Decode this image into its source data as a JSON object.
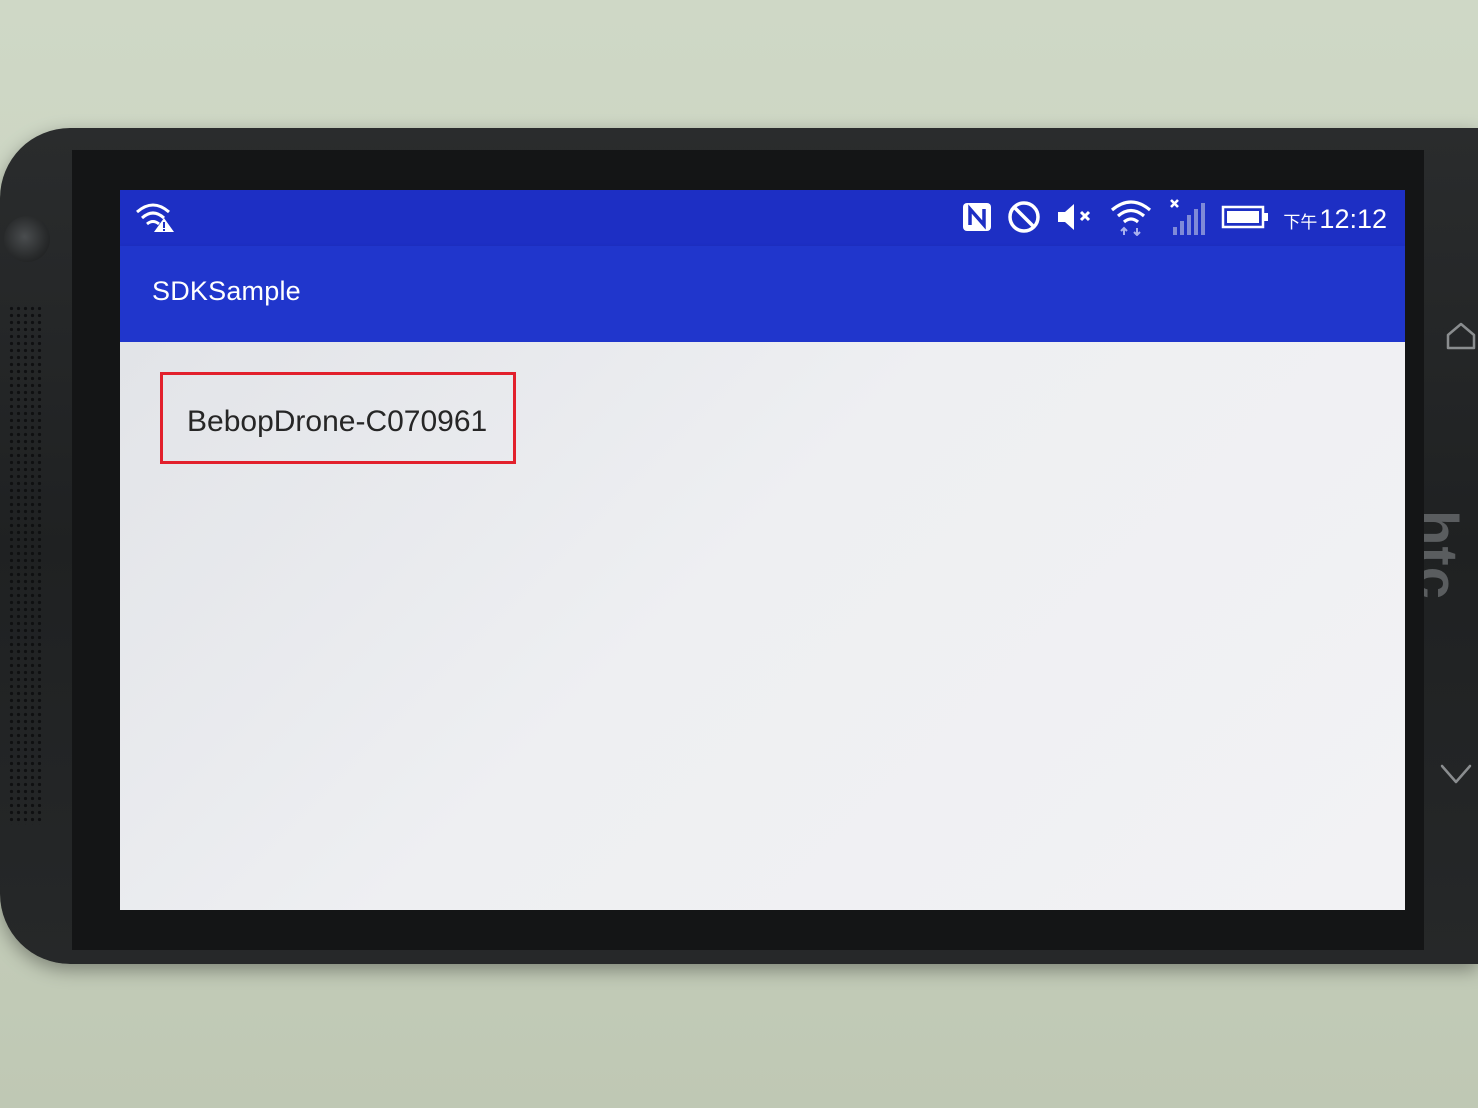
{
  "status_bar": {
    "time": "12:12",
    "ampm": "下午",
    "icons": [
      "wifi-warning-icon",
      "nfc-icon",
      "do-not-disturb-icon",
      "volume-muted-icon",
      "wifi-icon",
      "cellular-no-signal-icon",
      "battery-icon"
    ]
  },
  "app_bar": {
    "title": "SDKSample"
  },
  "device_list": {
    "items": [
      {
        "label": "BebopDrone-C070961"
      }
    ],
    "highlight_color": "#e2202c"
  },
  "hardware": {
    "brand_logo": "htc",
    "buttons": [
      "home-button",
      "back-button"
    ]
  },
  "colors": {
    "primary": "#2036cc",
    "primary_dark": "#1d2fc4",
    "background": "#eceef0"
  }
}
